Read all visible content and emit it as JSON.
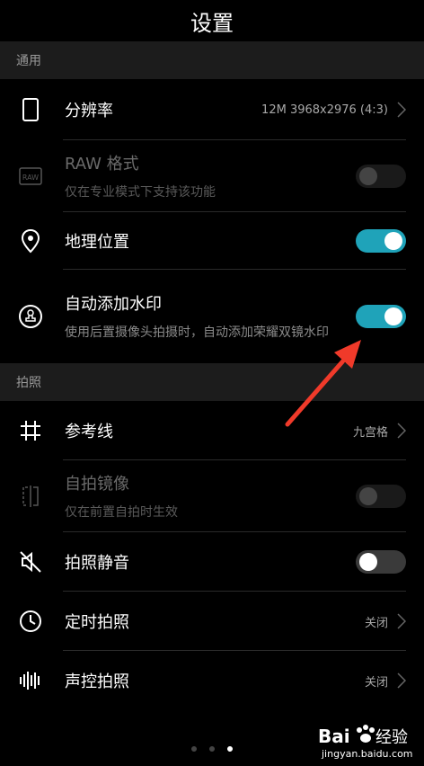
{
  "header": {
    "title": "设置"
  },
  "sections": [
    {
      "label": "通用"
    },
    {
      "label": "拍照"
    }
  ],
  "general": {
    "resolution": {
      "label": "分辨率",
      "value": "12M 3968x2976 (4:3)",
      "icon": "phone-icon"
    },
    "raw": {
      "label": "RAW 格式",
      "sub": "仅在专业模式下支持该功能",
      "icon": "raw-icon",
      "state": "disabled"
    },
    "location": {
      "label": "地理位置",
      "icon": "location-pin-icon",
      "state": "on"
    },
    "watermark": {
      "label": "自动添加水印",
      "sub": "使用后置摄像头拍摄时，自动添加荣耀双镜水印",
      "icon": "stamp-icon",
      "state": "on"
    }
  },
  "photo": {
    "grid": {
      "label": "参考线",
      "value": "九宫格",
      "icon": "grid-icon"
    },
    "mirror": {
      "label": "自拍镜像",
      "sub": "仅在前置自拍时生效",
      "icon": "mirror-icon",
      "state": "disabled"
    },
    "mute": {
      "label": "拍照静音",
      "icon": "mute-icon",
      "state": "off"
    },
    "timer": {
      "label": "定时拍照",
      "value": "关闭",
      "icon": "clock-icon"
    },
    "voice": {
      "label": "声控拍照",
      "value": "关闭",
      "icon": "soundwave-icon"
    }
  },
  "pager": {
    "count": 3,
    "active": 3
  },
  "watermark_logo": {
    "brand": "Bai",
    "suffix": "经验",
    "url": "jingyan.baidu.com"
  },
  "colors": {
    "accent": "#1fa3b9",
    "arrow": "#f03a2a"
  }
}
